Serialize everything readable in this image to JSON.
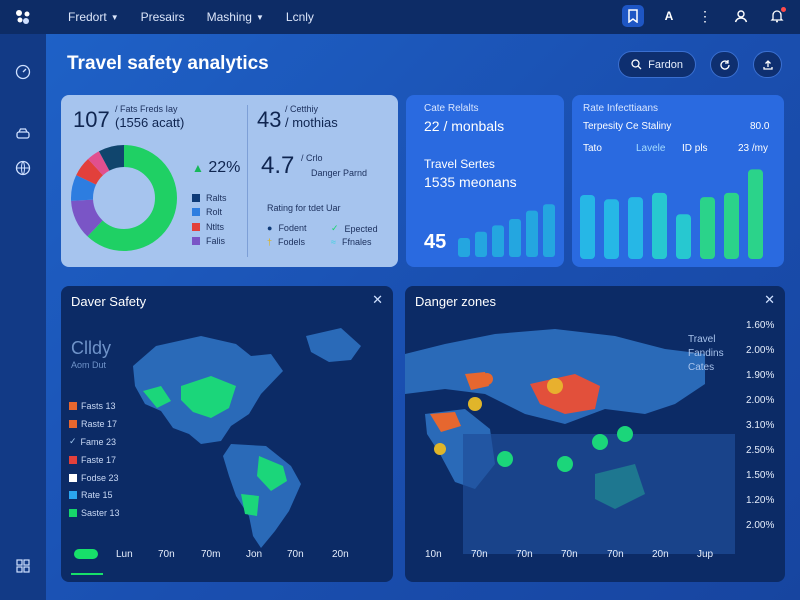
{
  "topbar": {
    "nav": [
      {
        "label": "Fredort",
        "has_caret": true
      },
      {
        "label": "Presairs",
        "has_caret": false
      },
      {
        "label": "Mashing",
        "has_caret": true
      },
      {
        "label": "Lcnly",
        "has_caret": false
      }
    ],
    "icons": [
      "bookmark-icon",
      "font-icon",
      "more-icon",
      "user-icon",
      "bell-icon"
    ]
  },
  "sidebar": {
    "icons": [
      "dashboard-icon",
      "car-icon",
      "globe-icon",
      "settings-icon"
    ]
  },
  "header": {
    "title": "Travel safety analytics",
    "search_label": "Fardon"
  },
  "summary_card": {
    "stat1_value": "107",
    "stat1_label": "/ Fats Freds Iay",
    "stat1_sub": "(1556 acatt)",
    "stat2_value": "43",
    "stat2_label": "/ Cetthiy",
    "stat2_sub": "/ mothias",
    "donut_center_pct": "22%",
    "donut_legend": [
      {
        "label": "Ralts",
        "color": "#0f3b78"
      },
      {
        "label": "Rolt",
        "color": "#2d7de0"
      },
      {
        "label": "Ntlts",
        "color": "#e2403b"
      },
      {
        "label": "Falis",
        "color": "#7a55c6"
      }
    ],
    "rating_value": "4.7",
    "rating_unit": "/ Crlo",
    "rating_sub": "Danger Parnd",
    "rating_heading": "Rating for tdet Uar",
    "rating_legend": [
      {
        "label": "Fodent",
        "color": "#0f3b78"
      },
      {
        "label": "Epected",
        "color": "#17d66a"
      },
      {
        "label": "Fodels",
        "color": "#d9b226"
      },
      {
        "label": "Ffnales",
        "color": "#3bd3e0"
      }
    ],
    "donut_values": [
      {
        "name": "green",
        "value": 62,
        "color": "#1fd064"
      },
      {
        "name": "purple",
        "value": 12,
        "color": "#7a55c6"
      },
      {
        "name": "blue",
        "value": 8,
        "color": "#2d7de0"
      },
      {
        "name": "red",
        "value": 6,
        "color": "#e2403b"
      },
      {
        "name": "pink",
        "value": 4,
        "color": "#e14f8e"
      },
      {
        "name": "navy",
        "value": 8,
        "color": "#10456d"
      }
    ]
  },
  "card_trend": {
    "title": "Cate Relalts",
    "value": "22 / monbals",
    "subtitle": "Travel Sertes",
    "subvalue": "1535 meonans",
    "big_value": "45",
    "bar_values": [
      18,
      24,
      30,
      36,
      44,
      50
    ],
    "color": "#24a6e0"
  },
  "card_bars": {
    "title": "Rate Infecttiaans",
    "metric_label": "Terpesity Ce Staliny",
    "metric_value": "80.0",
    "cols": [
      "Tato",
      "Lavele",
      "ID pls",
      "23 /my"
    ],
    "bar_values": [
      60,
      56,
      58,
      62,
      42,
      58,
      62,
      84
    ],
    "colors": [
      "#26b7e6",
      "#27c8d0",
      "#2bd38a"
    ]
  },
  "map_left": {
    "title": "Daver Safety",
    "overlay_title": "Clldy",
    "overlay_sub": "Aom Dut",
    "legend": [
      {
        "label": "Fasts 13",
        "color": "#e6672f"
      },
      {
        "label": "Raste 17",
        "color": "#e6672f"
      },
      {
        "label": "Fame 23",
        "color": "#9fc6f0",
        "check": true
      },
      {
        "label": "Faste 17",
        "color": "#e2403b"
      },
      {
        "label": "Fodse 23",
        "color": "#ffffff"
      },
      {
        "label": "Rate 15",
        "color": "#2aa6f0"
      },
      {
        "label": "Saster 13",
        "color": "#17d66a"
      }
    ],
    "timeline": [
      "Lun",
      "70n",
      "70m",
      "Jon",
      "70n",
      "20n"
    ]
  },
  "map_right": {
    "title": "Danger zones",
    "overlay_lines": [
      "Travel",
      "Fandins",
      "Cates"
    ],
    "y_axis": [
      "1.60%",
      "2.00%",
      "1.90%",
      "2.00%",
      "3.10%",
      "2.50%",
      "1.50%",
      "1.20%",
      "2.00%"
    ],
    "x_axis": [
      "10n",
      "70n",
      "70n",
      "70n",
      "70n",
      "20n",
      "Jup"
    ]
  }
}
